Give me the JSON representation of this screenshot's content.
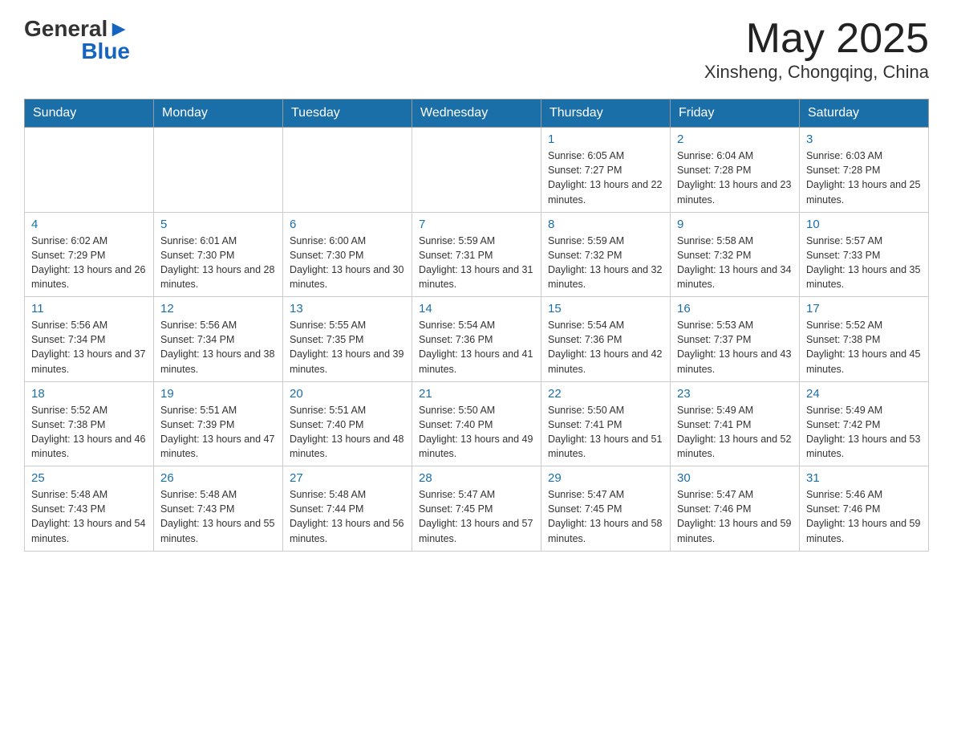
{
  "header": {
    "logo_general": "General",
    "logo_blue": "Blue",
    "title": "May 2025",
    "subtitle": "Xinsheng, Chongqing, China"
  },
  "calendar": {
    "days_of_week": [
      "Sunday",
      "Monday",
      "Tuesday",
      "Wednesday",
      "Thursday",
      "Friday",
      "Saturday"
    ],
    "weeks": [
      [
        {
          "day": "",
          "info": ""
        },
        {
          "day": "",
          "info": ""
        },
        {
          "day": "",
          "info": ""
        },
        {
          "day": "",
          "info": ""
        },
        {
          "day": "1",
          "info": "Sunrise: 6:05 AM\nSunset: 7:27 PM\nDaylight: 13 hours and 22 minutes."
        },
        {
          "day": "2",
          "info": "Sunrise: 6:04 AM\nSunset: 7:28 PM\nDaylight: 13 hours and 23 minutes."
        },
        {
          "day": "3",
          "info": "Sunrise: 6:03 AM\nSunset: 7:28 PM\nDaylight: 13 hours and 25 minutes."
        }
      ],
      [
        {
          "day": "4",
          "info": "Sunrise: 6:02 AM\nSunset: 7:29 PM\nDaylight: 13 hours and 26 minutes."
        },
        {
          "day": "5",
          "info": "Sunrise: 6:01 AM\nSunset: 7:30 PM\nDaylight: 13 hours and 28 minutes."
        },
        {
          "day": "6",
          "info": "Sunrise: 6:00 AM\nSunset: 7:30 PM\nDaylight: 13 hours and 30 minutes."
        },
        {
          "day": "7",
          "info": "Sunrise: 5:59 AM\nSunset: 7:31 PM\nDaylight: 13 hours and 31 minutes."
        },
        {
          "day": "8",
          "info": "Sunrise: 5:59 AM\nSunset: 7:32 PM\nDaylight: 13 hours and 32 minutes."
        },
        {
          "day": "9",
          "info": "Sunrise: 5:58 AM\nSunset: 7:32 PM\nDaylight: 13 hours and 34 minutes."
        },
        {
          "day": "10",
          "info": "Sunrise: 5:57 AM\nSunset: 7:33 PM\nDaylight: 13 hours and 35 minutes."
        }
      ],
      [
        {
          "day": "11",
          "info": "Sunrise: 5:56 AM\nSunset: 7:34 PM\nDaylight: 13 hours and 37 minutes."
        },
        {
          "day": "12",
          "info": "Sunrise: 5:56 AM\nSunset: 7:34 PM\nDaylight: 13 hours and 38 minutes."
        },
        {
          "day": "13",
          "info": "Sunrise: 5:55 AM\nSunset: 7:35 PM\nDaylight: 13 hours and 39 minutes."
        },
        {
          "day": "14",
          "info": "Sunrise: 5:54 AM\nSunset: 7:36 PM\nDaylight: 13 hours and 41 minutes."
        },
        {
          "day": "15",
          "info": "Sunrise: 5:54 AM\nSunset: 7:36 PM\nDaylight: 13 hours and 42 minutes."
        },
        {
          "day": "16",
          "info": "Sunrise: 5:53 AM\nSunset: 7:37 PM\nDaylight: 13 hours and 43 minutes."
        },
        {
          "day": "17",
          "info": "Sunrise: 5:52 AM\nSunset: 7:38 PM\nDaylight: 13 hours and 45 minutes."
        }
      ],
      [
        {
          "day": "18",
          "info": "Sunrise: 5:52 AM\nSunset: 7:38 PM\nDaylight: 13 hours and 46 minutes."
        },
        {
          "day": "19",
          "info": "Sunrise: 5:51 AM\nSunset: 7:39 PM\nDaylight: 13 hours and 47 minutes."
        },
        {
          "day": "20",
          "info": "Sunrise: 5:51 AM\nSunset: 7:40 PM\nDaylight: 13 hours and 48 minutes."
        },
        {
          "day": "21",
          "info": "Sunrise: 5:50 AM\nSunset: 7:40 PM\nDaylight: 13 hours and 49 minutes."
        },
        {
          "day": "22",
          "info": "Sunrise: 5:50 AM\nSunset: 7:41 PM\nDaylight: 13 hours and 51 minutes."
        },
        {
          "day": "23",
          "info": "Sunrise: 5:49 AM\nSunset: 7:41 PM\nDaylight: 13 hours and 52 minutes."
        },
        {
          "day": "24",
          "info": "Sunrise: 5:49 AM\nSunset: 7:42 PM\nDaylight: 13 hours and 53 minutes."
        }
      ],
      [
        {
          "day": "25",
          "info": "Sunrise: 5:48 AM\nSunset: 7:43 PM\nDaylight: 13 hours and 54 minutes."
        },
        {
          "day": "26",
          "info": "Sunrise: 5:48 AM\nSunset: 7:43 PM\nDaylight: 13 hours and 55 minutes."
        },
        {
          "day": "27",
          "info": "Sunrise: 5:48 AM\nSunset: 7:44 PM\nDaylight: 13 hours and 56 minutes."
        },
        {
          "day": "28",
          "info": "Sunrise: 5:47 AM\nSunset: 7:45 PM\nDaylight: 13 hours and 57 minutes."
        },
        {
          "day": "29",
          "info": "Sunrise: 5:47 AM\nSunset: 7:45 PM\nDaylight: 13 hours and 58 minutes."
        },
        {
          "day": "30",
          "info": "Sunrise: 5:47 AM\nSunset: 7:46 PM\nDaylight: 13 hours and 59 minutes."
        },
        {
          "day": "31",
          "info": "Sunrise: 5:46 AM\nSunset: 7:46 PM\nDaylight: 13 hours and 59 minutes."
        }
      ]
    ]
  }
}
